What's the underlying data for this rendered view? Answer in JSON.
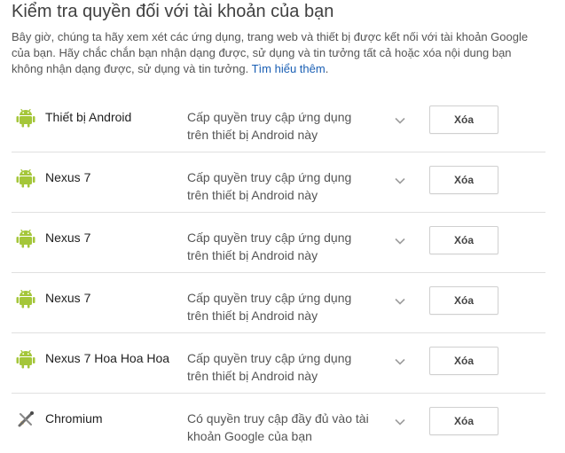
{
  "page": {
    "title": "Kiểm tra quyền đối với tài khoản của bạn",
    "intro_text": "Bây giờ, chúng ta hãy xem xét các ứng dụng, trang web và thiết bị được kết nối với tài khoản Google của bạn. Hãy chắc chắn bạn nhận dạng được, sử dụng và tin tưởng tất cả hoặc xóa nội dung bạn không nhận dạng được, sử dụng và tin tưởng. ",
    "learn_more": "Tìm hiểu thêm",
    "learn_more_suffix": "."
  },
  "colors": {
    "android_green": "#a4c639",
    "link": "#1a5fb4"
  },
  "apps": [
    {
      "icon": "android-icon",
      "name": "Thiết bị Android",
      "access_line1": "Cấp quyền truy cập ứng dụng",
      "access_line2": "trên thiết bị Android này",
      "delete_label": "Xóa"
    },
    {
      "icon": "android-icon",
      "name": "Nexus 7",
      "access_line1": "Cấp quyền truy cập ứng dụng",
      "access_line2": "trên thiết bị Android này",
      "delete_label": "Xóa"
    },
    {
      "icon": "android-icon",
      "name": "Nexus 7",
      "access_line1": "Cấp quyền truy cập ứng dụng",
      "access_line2": "trên thiết bị Android này",
      "delete_label": "Xóa"
    },
    {
      "icon": "android-icon",
      "name": "Nexus 7",
      "access_line1": "Cấp quyền truy cập ứng dụng",
      "access_line2": "trên thiết bị Android này",
      "delete_label": "Xóa"
    },
    {
      "icon": "android-icon",
      "name": "Nexus 7 Hoa Hoa Hoa",
      "access_line1": "Cấp quyền truy cập ứng dụng",
      "access_line2": "trên thiết bị Android này",
      "delete_label": "Xóa"
    },
    {
      "icon": "chromium-icon",
      "name": "Chromium",
      "access_line1": "Có quyền truy cập đầy đủ vào tài",
      "access_line2": "khoản Google của bạn",
      "delete_label": "Xóa"
    }
  ]
}
